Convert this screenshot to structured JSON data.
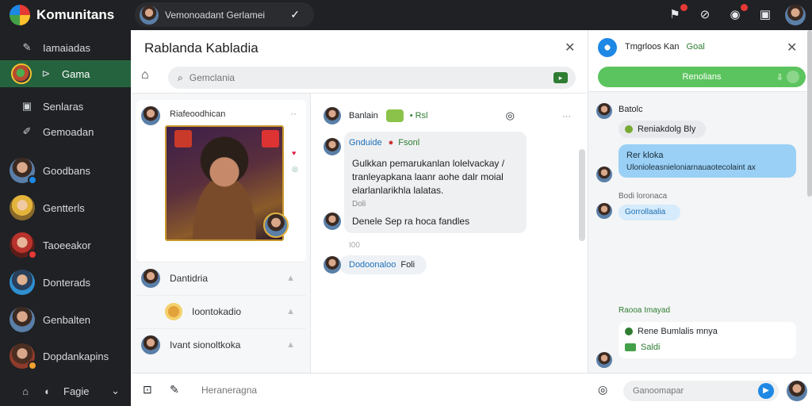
{
  "app": {
    "name": "Komunitans"
  },
  "topbar": {
    "user_name": "Vemonoadant Gerlamei",
    "check": "✓",
    "icons": [
      "alert-icon",
      "link-icon",
      "notification-icon",
      "window-icon"
    ]
  },
  "sidebar": {
    "items": [
      {
        "label": "Iamaiadas",
        "icon": "✎"
      },
      {
        "label": "Gama",
        "icon": "⊳"
      },
      {
        "label": "Senlaras",
        "icon": "▣"
      },
      {
        "label": "Gemoadan",
        "icon": "✐"
      },
      {
        "label": "Goodbans"
      },
      {
        "label": "Gentterls"
      },
      {
        "label": "Taoeeakor"
      },
      {
        "label": "Donterads"
      },
      {
        "label": "Genbalten"
      },
      {
        "label": "Dopdankapins"
      }
    ],
    "bottom": {
      "label": "Fagie",
      "chevron": "⌄"
    }
  },
  "conversation": {
    "title": "Rablanda Kabladia",
    "search_placeholder": "Gemclania"
  },
  "column1": {
    "post_author": "Riafeoodhican",
    "post_more": "··",
    "rows": [
      {
        "label": "Dantidria"
      },
      {
        "label": "Ioontokadio"
      },
      {
        "label": "Ivant sionoltkoka"
      }
    ]
  },
  "column2": {
    "head_name": "Banlain",
    "head_tag": "• Rsl",
    "head_more": "⋯",
    "sender": "Gnduide",
    "sender_tag": "Fsonl",
    "message": "Gulkkan pemarukanlan lolelvackay / tranleyapkana laanr aohe dalr moial elarlanlarikhla lalatas.",
    "meta": "Doli",
    "reply": "Denele Sep ra hoca fandles",
    "divider": "I00",
    "mini_name": "Dodoonaloo",
    "mini_tag": "Foli"
  },
  "right_panel": {
    "title": "Tmgrloos Kan",
    "title_tag": "Goal",
    "button_label": "Renolians",
    "chat": {
      "sender1": "Batolc",
      "pill_text": "Reniakdolg Bly",
      "blue_title": "Rer kloka",
      "blue_body": "Ulonioleasnieloniarnauaotecolaint ax",
      "meta": "Bodi loronaca",
      "lblue": "Gorrollaalia",
      "card_head": "Raooa Imayad",
      "card_line1": "Rene Bumlalis mnya",
      "card_line2": "Saldi"
    }
  },
  "compose": {
    "placeholder": "Heraneragna",
    "send_placeholder": "Ganoomapar"
  }
}
